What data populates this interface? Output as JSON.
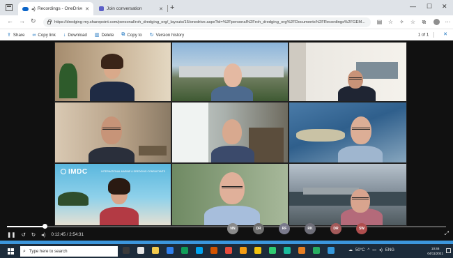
{
  "browser": {
    "tabs": [
      {
        "label": "Recordings - OneDrive",
        "active": true
      },
      {
        "label": "Join conversation",
        "active": false
      }
    ],
    "new_tab": "+",
    "window_controls": {
      "minimize": "—",
      "maximize": "☐",
      "close": "✕"
    },
    "url": "https://dredging-my.sharepoint.com/personal/roh_dredging_org/_layouts/15/onedrive.aspx?id=%2Fpersonal%2Froh_dredging_org%2FDocuments%2FRecordings%2FGEM..."
  },
  "commandbar": {
    "items": [
      {
        "label": "Share",
        "icon": "share-icon",
        "glyph": "⇪"
      },
      {
        "label": "Copy link",
        "icon": "link-icon",
        "glyph": "∞"
      },
      {
        "label": "Download",
        "icon": "download-icon",
        "glyph": "↓"
      },
      {
        "label": "Delete",
        "icon": "trash-icon",
        "glyph": "▥"
      },
      {
        "label": "Copy to",
        "icon": "copy-icon",
        "glyph": "⧉"
      },
      {
        "label": "Version history",
        "icon": "history-icon",
        "glyph": "↻"
      }
    ],
    "pager": "1 of 1"
  },
  "video": {
    "tiles": [
      {
        "name": "tile-woman-office",
        "bg": "c1"
      },
      {
        "name": "tile-man-outdoor-buildings",
        "bg": "c2"
      },
      {
        "name": "tile-man-glasses-office",
        "bg": "c3"
      },
      {
        "name": "tile-man-glasses-brown-room",
        "bg": "c4"
      },
      {
        "name": "tile-man-hand-chin",
        "bg": "c5"
      },
      {
        "name": "tile-man-island-aerial",
        "bg": "c6"
      },
      {
        "name": "tile-woman-imdc",
        "bg": "c7"
      },
      {
        "name": "tile-man-bald-green",
        "bg": "c8"
      },
      {
        "name": "tile-man-port-aerial",
        "bg": "c9"
      }
    ],
    "imdc_logo": "IMDC",
    "imdc_tagline": "INTERNATIONAL MARINE & DREDGING CONSULTANTS"
  },
  "player": {
    "progress_fraction": 0.085,
    "time_display": "0:12:45 / 2:54:31",
    "participants": [
      {
        "initials": "NN",
        "color": "#8a8a8a"
      },
      {
        "initials": "DR",
        "color": "#6d6d6d"
      },
      {
        "initials": "RF",
        "color": "#7a7a8c"
      },
      {
        "initials": "RK",
        "color": "#6e6e78"
      },
      {
        "initials": "DR",
        "color": "#a45a5a"
      },
      {
        "initials": "SW",
        "color": "#b04e4e"
      }
    ]
  },
  "taskbar": {
    "search_placeholder": "Type here to search",
    "apps": [
      "#3a3a3a",
      "#e6e6e6",
      "#f2c94c",
      "#2f80ed",
      "#0f9d58",
      "#00a4ef",
      "#d35400",
      "#e74c3c",
      "#f39c12",
      "#f1c40f",
      "#2ecc71",
      "#1abc9c",
      "#e67e22",
      "#27ae60",
      "#3498db"
    ],
    "weather": "50°C",
    "language": "ENG",
    "time": "10:46",
    "date": "04/11/2021"
  }
}
